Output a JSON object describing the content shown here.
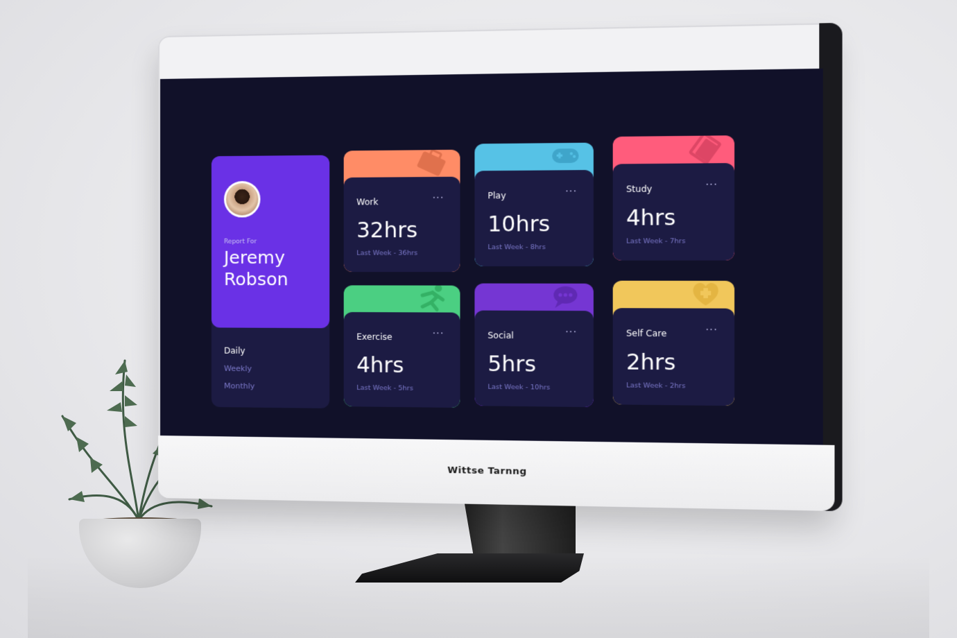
{
  "monitor": {
    "brand_text": "Wittse Tarnng"
  },
  "profile": {
    "report_for": "Report For",
    "name_line1": "Jeremy",
    "name_line2": "Robson",
    "periods": [
      "Daily",
      "Weekly",
      "Monthly"
    ],
    "active_period": "Daily"
  },
  "cards": [
    {
      "title": "Work",
      "hours": "32hrs",
      "last": "Last Week - 36hrs",
      "color": "#ff8c66",
      "icon": "briefcase-icon"
    },
    {
      "title": "Play",
      "hours": "10hrs",
      "last": "Last Week - 8hrs",
      "color": "#56c2e6",
      "icon": "gamepad-icon"
    },
    {
      "title": "Study",
      "hours": "4hrs",
      "last": "Last Week - 7hrs",
      "color": "#ff5c7c",
      "icon": "book-icon"
    },
    {
      "title": "Exercise",
      "hours": "4hrs",
      "last": "Last Week - 5hrs",
      "color": "#4bcf82",
      "icon": "runner-icon"
    },
    {
      "title": "Social",
      "hours": "5hrs",
      "last": "Last Week - 10hrs",
      "color": "#7536d3",
      "icon": "chat-icon"
    },
    {
      "title": "Self Care",
      "hours": "2hrs",
      "last": "Last Week - 2hrs",
      "color": "#f1c75b",
      "icon": "heart-plus-icon"
    }
  ],
  "menu_glyph": "···"
}
